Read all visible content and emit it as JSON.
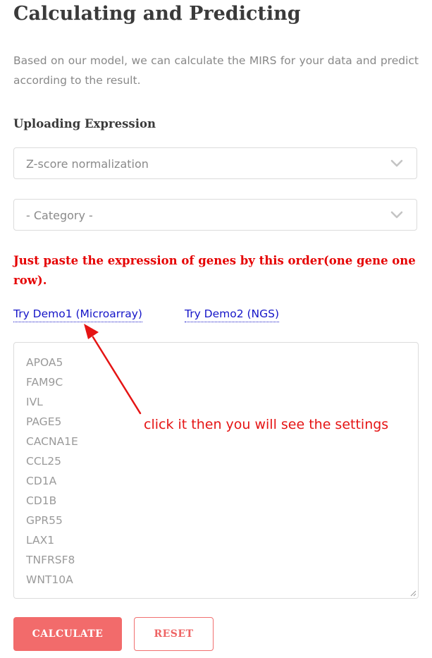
{
  "page": {
    "title": "Calculating and Predicting",
    "intro": "Based on our model, we can calculate the MIRS for your data and predict according to the result."
  },
  "upload": {
    "section_title": "Uploading Expression",
    "normalization_select": {
      "selected": "Z-score normalization"
    },
    "category_select": {
      "selected": "- Category -"
    },
    "instruction": "Just paste the expression of genes by this order(one gene one row).",
    "demo_links": {
      "demo1": "Try Demo1 (Microarray)",
      "demo2": "Try Demo2 (NGS)"
    },
    "genes": [
      "APOA5",
      "FAM9C",
      "IVL",
      "PAGE5",
      "CACNA1E",
      "CCL25",
      "CD1A",
      "CD1B",
      "GPR55",
      "LAX1",
      "TNFRSF8",
      "WNT10A"
    ]
  },
  "annotation": {
    "text": "click it then you will see the settings",
    "color": "#e51414"
  },
  "actions": {
    "calculate_label": "CALCULATE",
    "reset_label": "RESET"
  },
  "colors": {
    "accent": "#f26b6b",
    "instruction": "#e50000",
    "link": "#1515c8"
  },
  "icons": {
    "select_arrow": "chevron-down-icon",
    "annotation": "arrow-icon"
  }
}
